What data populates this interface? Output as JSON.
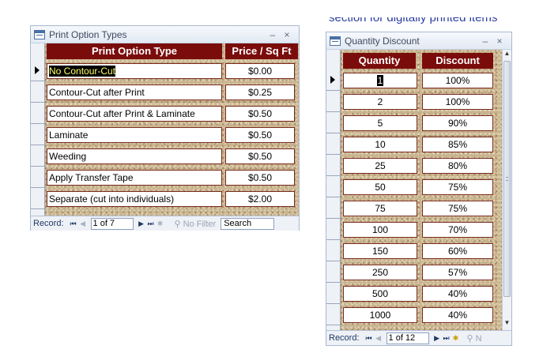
{
  "background_text": "section for digitally printed items",
  "print_window": {
    "title": "Print Option Types",
    "minimize": "–",
    "close": "×",
    "headers": {
      "type": "Print Option Type",
      "price": "Price / Sq Ft"
    },
    "rows": [
      {
        "type": "No Contour-Cut",
        "price": "$0.00"
      },
      {
        "type": "Contour-Cut after Print",
        "price": "$0.25"
      },
      {
        "type": "Contour-Cut after Print & Laminate",
        "price": "$0.50"
      },
      {
        "type": "Laminate",
        "price": "$0.50"
      },
      {
        "type": "Weeding",
        "price": "$0.50"
      },
      {
        "type": "Apply Transfer Tape",
        "price": "$0.50"
      },
      {
        "type": "Separate (cut into individuals)",
        "price": "$2.00"
      }
    ],
    "nav": {
      "label": "Record:",
      "position": "1 of 7",
      "filter": "No Filter",
      "search": "Search"
    }
  },
  "quantity_window": {
    "title": "Quantity Discount",
    "minimize": "–",
    "close": "×",
    "headers": {
      "quantity": "Quantity",
      "discount": "Discount"
    },
    "rows": [
      {
        "quantity": "1",
        "discount": "100%"
      },
      {
        "quantity": "2",
        "discount": "100%"
      },
      {
        "quantity": "5",
        "discount": "90%"
      },
      {
        "quantity": "10",
        "discount": "85%"
      },
      {
        "quantity": "25",
        "discount": "80%"
      },
      {
        "quantity": "50",
        "discount": "75%"
      },
      {
        "quantity": "75",
        "discount": "75%"
      },
      {
        "quantity": "100",
        "discount": "70%"
      },
      {
        "quantity": "150",
        "discount": "60%"
      },
      {
        "quantity": "250",
        "discount": "57%"
      },
      {
        "quantity": "500",
        "discount": "40%"
      },
      {
        "quantity": "1000",
        "discount": "40%"
      }
    ],
    "nav": {
      "label": "Record:",
      "position": "1 of 12",
      "filter": "N"
    }
  },
  "colors": {
    "header_bg": "#7b0c0c",
    "cell_border": "#7a2a1e",
    "texture": "#c9b48e",
    "chrome": "#eef1f6"
  },
  "icons": [
    "form-window-icon",
    "first-record-icon",
    "prev-record-icon",
    "next-record-icon",
    "last-record-icon",
    "new-record-icon",
    "filter-icon",
    "record-selector-arrow-icon"
  ]
}
